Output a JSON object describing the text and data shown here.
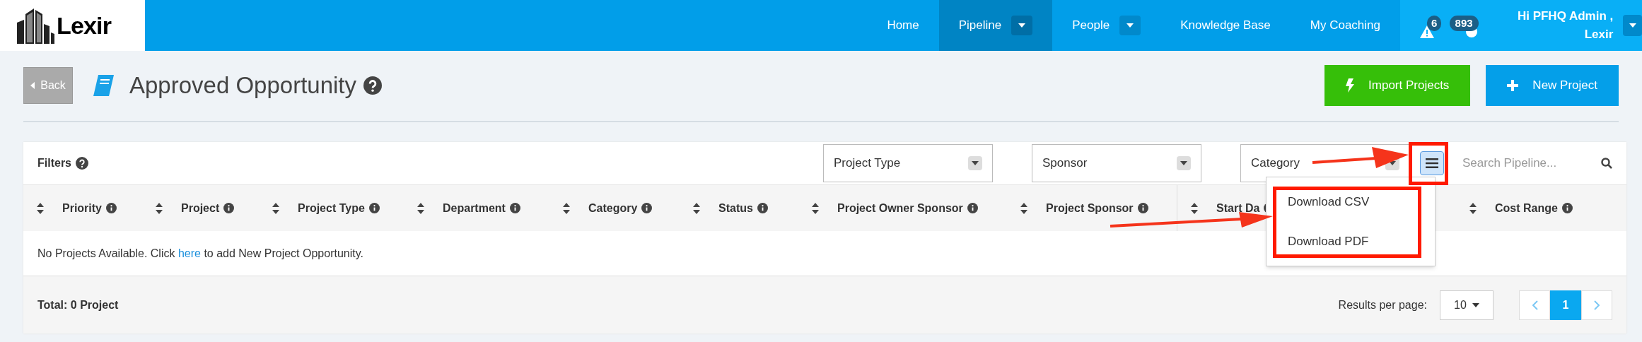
{
  "logo": {
    "text": "Lexir"
  },
  "nav": {
    "items": [
      {
        "label": "Home",
        "selected": false,
        "dropdown": false
      },
      {
        "label": "Pipeline",
        "selected": true,
        "dropdown": true
      },
      {
        "label": "People",
        "selected": false,
        "dropdown": true
      },
      {
        "label": "Knowledge Base",
        "selected": false,
        "dropdown": false
      },
      {
        "label": "My Coaching",
        "selected": false,
        "dropdown": false
      }
    ],
    "alerts_badge": "6",
    "messages_badge": "893",
    "user_line_1": "Hi PFHQ Admin ,",
    "user_line_2": "Lexir"
  },
  "header": {
    "back": "Back",
    "title": "Approved Opportunity",
    "buttons": [
      {
        "label": "Import Projects",
        "kind": "import"
      },
      {
        "label": "New Project",
        "kind": "new"
      }
    ]
  },
  "filters": {
    "label": "Filters",
    "selects": [
      "Project Type",
      "Sponsor",
      "Category"
    ],
    "search_placeholder": "Search Pipeline...",
    "menu": [
      "Download CSV",
      "Download PDF"
    ]
  },
  "table": {
    "columns": [
      "Priority",
      "Project",
      "Project Type",
      "Department",
      "Category",
      "Status",
      "Project Owner Sponsor",
      "Project Sponsor",
      "Start Da",
      "Cost Range"
    ],
    "empty_before": "No Projects Available. Click ",
    "empty_link": "here",
    "empty_after": " to add New Project Opportunity."
  },
  "footer": {
    "total": "Total: 0 Project",
    "results_label": "Results per page:",
    "per_page": "10",
    "pages": [
      {
        "label": "1",
        "selected": true
      }
    ]
  }
}
